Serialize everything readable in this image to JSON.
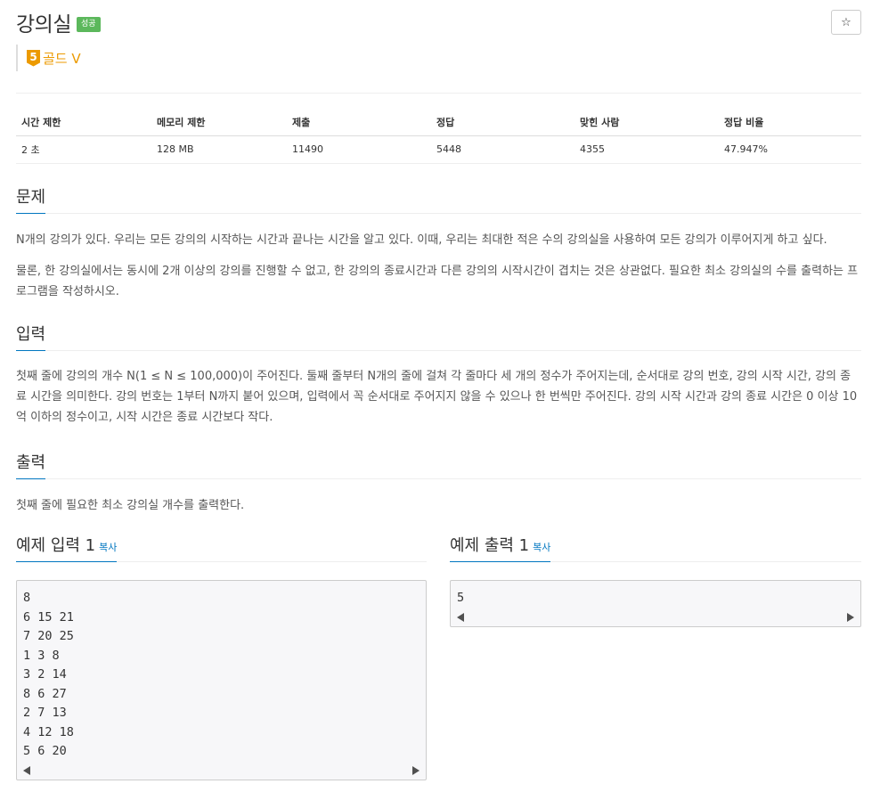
{
  "problem": {
    "title": "강의실",
    "status": "성공",
    "star": "☆",
    "tier_number": "5",
    "tier": "골드 V"
  },
  "info_table": {
    "headers": [
      "시간 제한",
      "메모리 제한",
      "제출",
      "정답",
      "맞힌 사람",
      "정답 비율"
    ],
    "values": [
      "2 초",
      "128 MB",
      "11490",
      "5448",
      "4355",
      "47.947%"
    ]
  },
  "sections": {
    "problem": {
      "title": "문제",
      "paragraphs": [
        "N개의 강의가 있다. 우리는 모든 강의의 시작하는 시간과 끝나는 시간을 알고 있다. 이때, 우리는 최대한 적은 수의 강의실을 사용하여 모든 강의가 이루어지게 하고 싶다.",
        "물론, 한 강의실에서는 동시에 2개 이상의 강의를 진행할 수 없고, 한 강의의 종료시간과 다른 강의의 시작시간이 겹치는 것은 상관없다. 필요한 최소 강의실의 수를 출력하는 프로그램을 작성하시오."
      ]
    },
    "input": {
      "title": "입력",
      "paragraph": "첫째 줄에 강의의 개수 N(1 ≤ N ≤ 100,000)이 주어진다. 둘째 줄부터 N개의 줄에 걸쳐 각 줄마다 세 개의 정수가 주어지는데, 순서대로 강의 번호, 강의 시작 시간, 강의 종료 시간을 의미한다. 강의 번호는 1부터 N까지 붙어 있으며, 입력에서 꼭 순서대로 주어지지 않을 수 있으나 한 번씩만 주어진다. 강의 시작 시간과 강의 종료 시간은 0 이상 10억 이하의 정수이고, 시작 시간은 종료 시간보다 작다."
    },
    "output": {
      "title": "출력",
      "paragraph": "첫째 줄에 필요한 최소 강의실 개수를 출력한다."
    }
  },
  "samples": {
    "input": {
      "title": "예제 입력 1",
      "copy": "복사",
      "lines": [
        "8",
        "6 15 21",
        "7 20 25",
        "1 3 8",
        "3 2 14",
        "8 6 27",
        "2 7 13",
        "4 12 18",
        "5 6 20"
      ]
    },
    "output": {
      "title": "예제 출력 1",
      "copy": "복사",
      "lines": [
        "5"
      ]
    }
  }
}
